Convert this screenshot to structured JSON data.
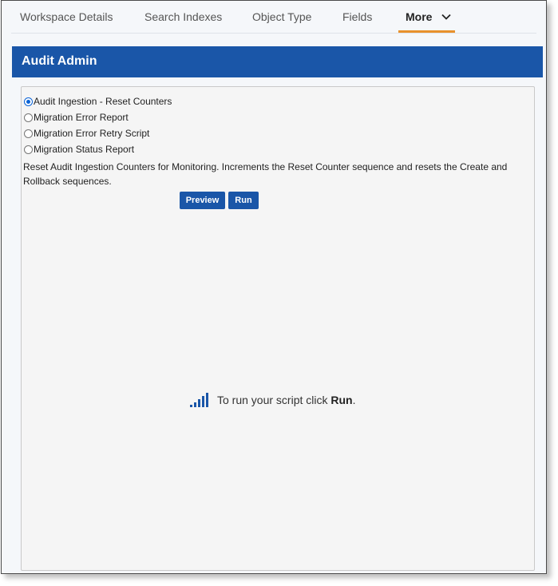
{
  "tabs": [
    {
      "label": "Workspace Details"
    },
    {
      "label": "Search Indexes"
    },
    {
      "label": "Object Type"
    },
    {
      "label": "Fields"
    },
    {
      "label": "More",
      "active": true
    }
  ],
  "header": {
    "title": "Audit Admin"
  },
  "options": [
    {
      "label": "Audit Ingestion - Reset Counters",
      "checked": true
    },
    {
      "label": "Migration Error Report",
      "checked": false
    },
    {
      "label": "Migration Error Retry Script",
      "checked": false
    },
    {
      "label": "Migration Status Report",
      "checked": false
    }
  ],
  "description": "Reset Audit Ingestion Counters for Monitoring. Increments the Reset Counter sequence and resets the Create and Rollback sequences.",
  "buttons": {
    "preview": "Preview",
    "run": "Run"
  },
  "hint": {
    "prefix": "To run your script click ",
    "emphasis": "Run",
    "suffix": "."
  },
  "colors": {
    "accent": "#1a56a8",
    "tab_underline": "#e8912c"
  }
}
